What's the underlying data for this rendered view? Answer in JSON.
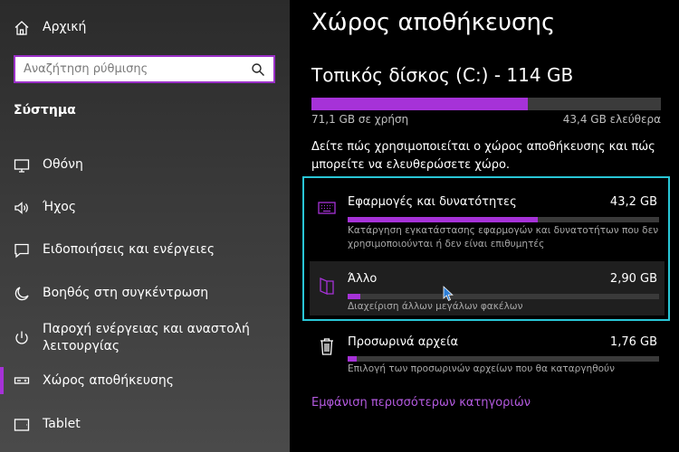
{
  "sidebar": {
    "home_label": "Αρχική",
    "search_placeholder": "Αναζήτηση ρύθμισης",
    "section_title": "Σύστημα",
    "items": [
      {
        "label": "Οθόνη",
        "icon": "monitor-icon"
      },
      {
        "label": "Ήχος",
        "icon": "speaker-icon"
      },
      {
        "label": "Ειδοποιήσεις και ενέργειες",
        "icon": "notification-icon"
      },
      {
        "label": "Βοηθός στη συγκέντρωση",
        "icon": "moon-icon"
      },
      {
        "label": "Παροχή ενέργειας και αναστολή λειτουργίας",
        "icon": "power-icon"
      },
      {
        "label": "Χώρος αποθήκευσης",
        "icon": "storage-icon",
        "selected": true
      },
      {
        "label": "Tablet",
        "icon": "tablet-icon"
      }
    ]
  },
  "main": {
    "title": "Χώρος αποθήκευσης",
    "drive": {
      "title": "Τοπικός δίσκος (C:) - 114 GB",
      "used_label": "71,1 GB σε χρήση",
      "free_label": "43,4 GB ελεύθερα",
      "used_fraction": 0.62
    },
    "description": "Δείτε πώς χρησιμοποιείται ο χώρος αποθήκευσης και πώς μπορείτε να ελευθερώσετε χώρο.",
    "categories": [
      {
        "name": "Εφαρμογές και δυνατότητες",
        "size": "43,2 GB",
        "description": "Κατάργηση εγκατάστασης εφαρμογών και δυνατοτήτων που δεν χρησιμοποιούνται ή δεν είναι επιθυμητές",
        "usage_fraction": 0.61,
        "icon": "apps-keyboard-icon"
      },
      {
        "name": "Άλλο",
        "size": "2,90 GB",
        "description": "Διαχείριση άλλων μεγάλων φακέλων",
        "usage_fraction": 0.04,
        "icon": "folder-icon"
      },
      {
        "name": "Προσωρινά αρχεία",
        "size": "1,76 GB",
        "description": "Επιλογή των προσωρινών αρχείων που θα καταργηθούν",
        "usage_fraction": 0.03,
        "icon": "trash-icon"
      }
    ],
    "more_link": "Εμφάνιση περισσότερων κατηγοριών"
  },
  "colors": {
    "accent": "#a632d8",
    "link": "#b45ae0",
    "focus": "#29c6d6",
    "background": "#000000"
  }
}
